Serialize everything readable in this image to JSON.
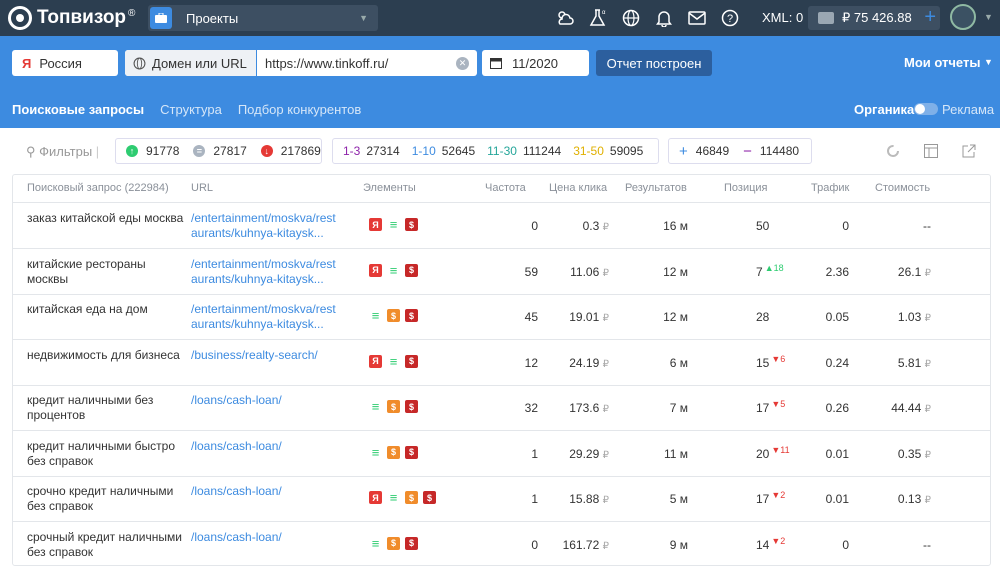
{
  "app": {
    "name": "Топвизор",
    "reg": "®",
    "project_label": "Проекты",
    "xml": "XML: 0",
    "balance": "₽ 75 426.88",
    "plus": "+"
  },
  "icons": {
    "logo": "topvisor-logo-icon",
    "project": "briefcase-icon",
    "weather": "weather-icon",
    "lab": "flask-icon",
    "globe": "globe-icon",
    "bell": "bell-icon",
    "mail": "mail-icon",
    "help": "help-icon",
    "wallet": "wallet-icon",
    "user": "avatar-icon"
  },
  "toolbar": {
    "engine": "Россия",
    "mode": "Домен или URL",
    "url": "https://www.tinkoff.ru/",
    "date": "11/2020",
    "report_btn": "Отчет построен",
    "my_reports": "Мои отчеты"
  },
  "tabs": [
    "Поисковые запросы",
    "Структура",
    "Подбор конкурентов"
  ],
  "toggle": {
    "left": "Органика",
    "right": "Реклама"
  },
  "filters": {
    "label": "Фильтры",
    "up": "91778",
    "eq": "27817",
    "down": "217869",
    "r1_3_label": "1-3",
    "r1_3": "27314",
    "r1_10_label": "1-10",
    "r1_10": "52645",
    "r11_30_label": "11-30",
    "r11_30": "111244",
    "r31_50_label": "31-50",
    "r31_50": "59095",
    "plus": "+",
    "plus_v": "46849",
    "minus": "−",
    "minus_v": "114480"
  },
  "colors": {
    "accent": "#3d8be0",
    "dark": "#2c3e50",
    "green": "#2ecc71",
    "red": "#e53935",
    "purple": "#8e24aa",
    "teal": "#26a69a",
    "yellow": "#e0b000"
  },
  "table": {
    "headers": [
      "Поисковый запрос (222984)",
      "URL",
      "Элементы",
      "Частота",
      "Цена клика",
      "Результатов",
      "Позиция",
      "Трафик",
      "Стоимость"
    ],
    "currency": "₽",
    "rows": [
      {
        "query": "заказ китайской еды москва",
        "url": "/entertainment/moskva/restaurants/kuhnya-kitaysk...",
        "els": [
          "y",
          "l",
          "r"
        ],
        "freq": "0",
        "cpc": "0.3",
        "res": "16 м",
        "pos": "50",
        "delta": "",
        "dir": "",
        "traffic": "0",
        "cost": "--"
      },
      {
        "query": "китайские рестораны москвы",
        "url": "/entertainment/moskva/restaurants/kuhnya-kitaysk...",
        "els": [
          "y",
          "l",
          "r"
        ],
        "freq": "59",
        "cpc": "11.06",
        "res": "12 м",
        "pos": "7",
        "delta": "18",
        "dir": "up",
        "traffic": "2.36",
        "cost": "26.1"
      },
      {
        "query": "китайская еда на дом",
        "url": "/entertainment/moskva/restaurants/kuhnya-kitaysk...",
        "els": [
          "l",
          "o",
          "r"
        ],
        "freq": "45",
        "cpc": "19.01",
        "res": "12 м",
        "pos": "28",
        "delta": "",
        "dir": "",
        "traffic": "0.05",
        "cost": "1.03"
      },
      {
        "query": "недвижимость для бизнеса",
        "url": "/business/realty-search/",
        "els": [
          "y",
          "l",
          "r"
        ],
        "freq": "12",
        "cpc": "24.19",
        "res": "6 м",
        "pos": "15",
        "delta": "6",
        "dir": "down",
        "traffic": "0.24",
        "cost": "5.81"
      },
      {
        "query": "кредит наличными без процентов",
        "url": "/loans/cash-loan/",
        "els": [
          "l",
          "o",
          "r"
        ],
        "freq": "32",
        "cpc": "173.6",
        "res": "7 м",
        "pos": "17",
        "delta": "5",
        "dir": "down",
        "traffic": "0.26",
        "cost": "44.44"
      },
      {
        "query": "кредит наличными быстро без справок",
        "url": "/loans/cash-loan/",
        "els": [
          "l",
          "o",
          "r"
        ],
        "freq": "1",
        "cpc": "29.29",
        "res": "11 м",
        "pos": "20",
        "delta": "11",
        "dir": "down",
        "traffic": "0.01",
        "cost": "0.35"
      },
      {
        "query": "срочно кредит наличными без справок",
        "url": "/loans/cash-loan/",
        "els": [
          "y",
          "l",
          "o",
          "r"
        ],
        "freq": "1",
        "cpc": "15.88",
        "res": "5 м",
        "pos": "17",
        "delta": "2",
        "dir": "down",
        "traffic": "0.01",
        "cost": "0.13"
      },
      {
        "query": "срочный кредит наличными без справок",
        "url": "/loans/cash-loan/",
        "els": [
          "l",
          "o",
          "r"
        ],
        "freq": "0",
        "cpc": "161.72",
        "res": "9 м",
        "pos": "14",
        "delta": "2",
        "dir": "down",
        "traffic": "0",
        "cost": "--"
      }
    ]
  }
}
